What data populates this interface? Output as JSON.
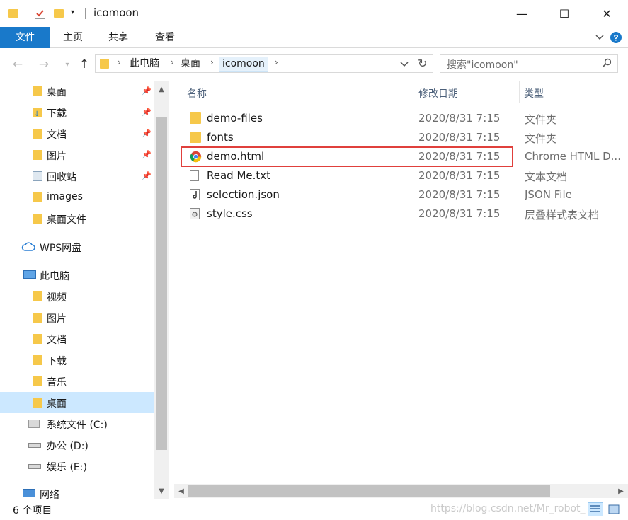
{
  "window": {
    "title": "icomoon",
    "controls": {
      "minimize": "—",
      "maximize": "☐",
      "close": "✕"
    }
  },
  "ribbon": {
    "tabs": [
      "文件",
      "主页",
      "共享",
      "查看"
    ]
  },
  "address": {
    "crumbs": [
      "此电脑",
      "桌面",
      "icomoon"
    ],
    "search_placeholder": "搜索\"icomoon\""
  },
  "nav": {
    "quick_access": [
      {
        "label": "桌面",
        "icon": "desktop-folder-icon",
        "pinned": true
      },
      {
        "label": "下载",
        "icon": "downloads-icon",
        "pinned": true
      },
      {
        "label": "文档",
        "icon": "documents-icon",
        "pinned": true
      },
      {
        "label": "图片",
        "icon": "pictures-icon",
        "pinned": true
      },
      {
        "label": "回收站",
        "icon": "recycle-bin-icon",
        "pinned": true
      },
      {
        "label": "images",
        "icon": "folder-icon",
        "pinned": false
      },
      {
        "label": "桌面文件",
        "icon": "folder-icon",
        "pinned": false
      }
    ],
    "wps": {
      "label": "WPS网盘",
      "icon": "cloud-icon"
    },
    "this_pc": {
      "label": "此电脑",
      "icon": "computer-icon"
    },
    "pc_items": [
      {
        "label": "视频",
        "icon": "videos-icon"
      },
      {
        "label": "图片",
        "icon": "pictures-icon"
      },
      {
        "label": "文档",
        "icon": "documents-icon"
      },
      {
        "label": "下载",
        "icon": "downloads-icon"
      },
      {
        "label": "音乐",
        "icon": "music-icon"
      },
      {
        "label": "桌面",
        "icon": "desktop-folder-icon",
        "selected": true
      },
      {
        "label": "系统文件 (C:)",
        "icon": "windows-drive-icon"
      },
      {
        "label": "办公 (D:)",
        "icon": "drive-icon"
      },
      {
        "label": "娱乐 (E:)",
        "icon": "drive-icon"
      }
    ],
    "network": {
      "label": "网络",
      "icon": "network-icon"
    }
  },
  "columns": {
    "name": "名称",
    "modified": "修改日期",
    "type": "类型"
  },
  "files": [
    {
      "name": "demo-files",
      "date": "2020/8/31 7:15",
      "type": "文件夹",
      "icon": "folder-icon"
    },
    {
      "name": "fonts",
      "date": "2020/8/31 7:15",
      "type": "文件夹",
      "icon": "folder-icon"
    },
    {
      "name": "demo.html",
      "date": "2020/8/31 7:15",
      "type": "Chrome HTML D...",
      "icon": "chrome-icon",
      "highlighted": true
    },
    {
      "name": "Read Me.txt",
      "date": "2020/8/31 7:15",
      "type": "文本文档",
      "icon": "text-file-icon"
    },
    {
      "name": "selection.json",
      "date": "2020/8/31 7:15",
      "type": "JSON File",
      "icon": "json-file-icon"
    },
    {
      "name": "style.css",
      "date": "2020/8/31 7:15",
      "type": "层叠样式表文档",
      "icon": "css-file-icon"
    }
  ],
  "status": {
    "count": "6 个项目",
    "watermark": "https://blog.csdn.net/Mr_robot_"
  },
  "colors": {
    "accent": "#1979ca",
    "selection": "#cce8ff",
    "highlight_border": "#e0403c",
    "folder": "#f6c84a"
  }
}
